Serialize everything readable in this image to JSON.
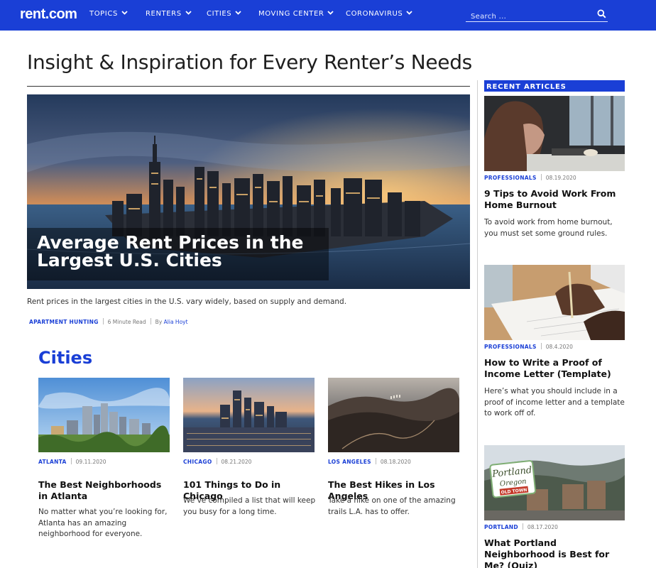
{
  "nav": {
    "logo": "rent.com",
    "items": [
      {
        "label": "TOPICS"
      },
      {
        "label": "RENTERS"
      },
      {
        "label": "CITIES"
      },
      {
        "label": "MOVING CENTER"
      },
      {
        "label": "CORONAVIRUS"
      }
    ],
    "search_placeholder": "Search ..."
  },
  "colors": {
    "brand": "#1a3fd6"
  },
  "page_title": "Insight & Inspiration for Every Renter’s Needs",
  "hero": {
    "caption": "Average Rent Prices in the Largest U.S. Cities",
    "description": "Rent prices in the largest cities in the U.S. vary widely, based on supply and demand.",
    "category": "APARTMENT HUNTING",
    "read_time": "6 Minute Read",
    "by_label": "By",
    "author": "Alia Hoyt"
  },
  "cities_section": {
    "heading": "Cities",
    "cards": [
      {
        "category": "ATLANTA",
        "date": "09.11.2020",
        "title": "The Best Neighborhoods in Atlanta",
        "description": "No matter what you’re looking for, Atlanta has an amazing neighborhood for everyone."
      },
      {
        "category": "CHICAGO",
        "date": "08.21.2020",
        "title": "101 Things to Do in Chicago",
        "description": "We’ve compiled a list that will keep you busy for a long time."
      },
      {
        "category": "LOS ANGELES",
        "date": "08.18.2020",
        "title": "The Best Hikes in Los Angeles",
        "description": "Take a hike on one of the amazing trails L.A. has to offer."
      }
    ]
  },
  "sidebar": {
    "heading": "RECENT ARTICLES",
    "articles": [
      {
        "category": "PROFESSIONALS",
        "date": "08.19.2020",
        "title": "9 Tips to Avoid Work From Home Burnout",
        "description": "To avoid work from home burnout, you must set some ground rules."
      },
      {
        "category": "PROFESSIONALS",
        "date": "08.4.2020",
        "title": "How to Write a Proof of Income Letter (Template)",
        "description": "Here’s what you should include in a proof of income letter and a template to work off of."
      },
      {
        "category": "PORTLAND",
        "date": "08.17.2020",
        "title": "What Portland Neighborhood is Best for Me? (Quiz)",
        "description": ""
      }
    ]
  },
  "image_text": {
    "portland_sign_line1": "Portland",
    "portland_sign_line2": "Oregon",
    "portland_sign_line3": "OLD TOWN"
  }
}
